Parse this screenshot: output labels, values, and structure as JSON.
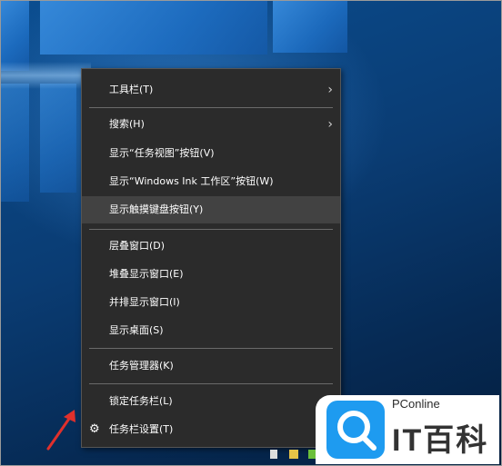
{
  "context_menu": {
    "items": [
      {
        "label": "工具栏(T)",
        "submenu": true
      },
      {
        "label": "搜索(H)",
        "submenu": true
      },
      {
        "label": "显示“任务视图”按钮(V)"
      },
      {
        "label": "显示“Windows Ink 工作区”按钮(W)"
      },
      {
        "label": "显示触摸键盘按钮(Y)",
        "highlighted": true
      },
      {
        "label": "层叠窗口(D)"
      },
      {
        "label": "堆叠显示窗口(E)"
      },
      {
        "label": "并排显示窗口(I)"
      },
      {
        "label": "显示桌面(S)"
      },
      {
        "label": "任务管理器(K)"
      },
      {
        "label": "锁定任务栏(L)"
      },
      {
        "label": "任务栏设置(T)",
        "icon": "gear-icon"
      }
    ],
    "arrow_glyph": "›",
    "gear_glyph": "⚙"
  },
  "watermark": {
    "brand_top": "PConline",
    "brand_main": "IT百科",
    "accent": "#1e9bf0"
  },
  "annotation": {
    "color": "#e0302c",
    "icon": "pointer-arrow"
  }
}
